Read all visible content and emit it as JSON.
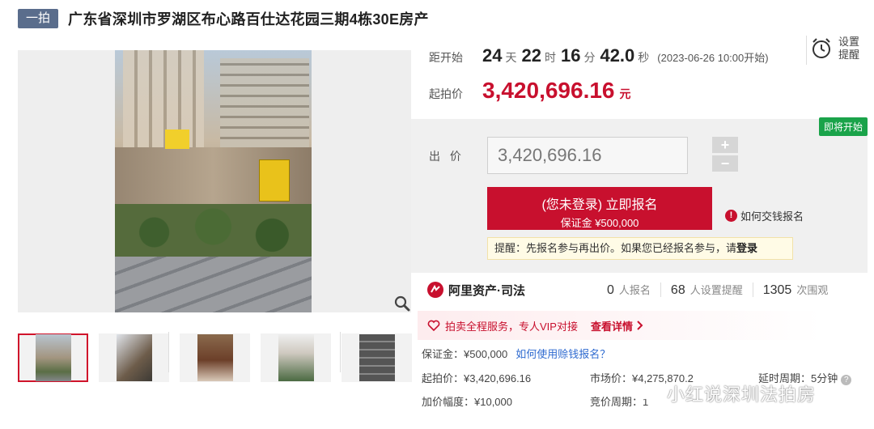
{
  "header": {
    "badge": "一拍",
    "title": "广东省深圳市罗湖区布心路百仕达花园三期4栋30E房产"
  },
  "countdown": {
    "label": "距开始",
    "days": "24",
    "days_unit": "天",
    "hours": "22",
    "hours_unit": "时",
    "minutes": "16",
    "minutes_unit": "分",
    "seconds": "42.0",
    "seconds_unit": "秒",
    "start_time": "(2023-06-26 10:00开始)"
  },
  "remind": {
    "label": "设置提醒",
    "icon": "alarm-clock-icon"
  },
  "start_price": {
    "label": "起拍价",
    "value": "3,420,696.16",
    "unit": "元"
  },
  "bid": {
    "status_badge": "即将开始",
    "label": "出 价",
    "input_value": "3,420,696.16",
    "plus": "+",
    "minus": "−",
    "register_main": "(您未登录) 立即报名",
    "register_sub": "保证金 ¥500,000",
    "how_pay": "如何交钱报名",
    "tip_prefix": "提醒：先报名参与再出价。如果您已经报名参与，请",
    "tip_login": "登录"
  },
  "stats": {
    "brand": "阿里资产·司法",
    "applicants_num": "0",
    "applicants_label": "人报名",
    "reminders_num": "68",
    "reminders_label": "人设置提醒",
    "views_num": "1305",
    "views_label": "次围观"
  },
  "vip": {
    "text": "拍卖全程服务，专人VIP对接",
    "link": "查看详情"
  },
  "details": {
    "deposit": "保证金：¥500,000",
    "deposit_link": "如何使用赊钱报名？",
    "start_price": "起拍价：¥3,420,696.16",
    "market_price": "市场价：¥4,275,870.2",
    "extension": "延时周期：5分钟",
    "increment": "加价幅度：¥10,000",
    "bid_cycle": "竞价周期：1"
  },
  "watermark": "小红说深圳法拍房",
  "colors": {
    "accent": "#c8102e",
    "badge": "#5a6d8c",
    "green": "#1aa34a",
    "link": "#2f6bd0"
  }
}
